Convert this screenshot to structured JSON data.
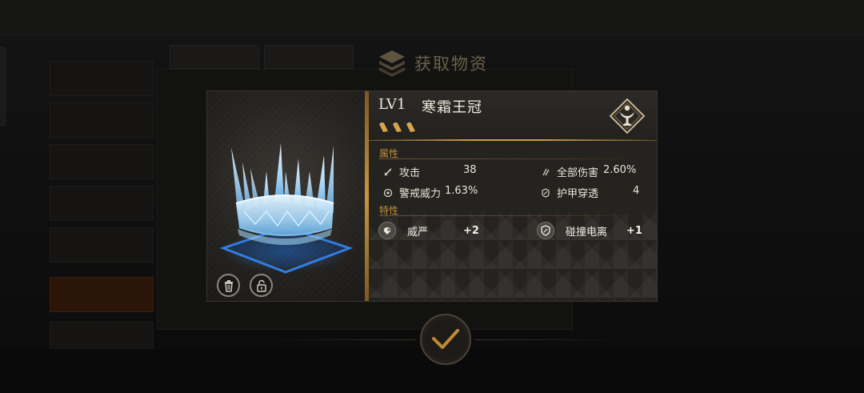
{
  "dialog": {
    "title": "获取物资"
  },
  "item": {
    "level": "LV1",
    "name": "寒霜王冠",
    "stars": 3
  },
  "attributes": {
    "section_label": "属性",
    "stats": [
      {
        "name": "攻击",
        "value": "38"
      },
      {
        "name": "全部伤害",
        "value": "2.60%"
      },
      {
        "name": "警戒威力",
        "value": "1.63%"
      },
      {
        "name": "护甲穿透",
        "value": "4"
      }
    ]
  },
  "traits": {
    "section_label": "特性",
    "items": [
      {
        "name": "威严",
        "value": "+2"
      },
      {
        "name": "碰撞电离",
        "value": "+1"
      }
    ]
  },
  "colors": {
    "accent_gold": "#c99a4a",
    "crown_ice": "#a9d8f6",
    "base_glow": "#2f7fe0"
  },
  "icons": [
    "trash-icon",
    "unlock-icon",
    "stack-icon",
    "chalice-emblem-icon",
    "checkmark-icon"
  ]
}
